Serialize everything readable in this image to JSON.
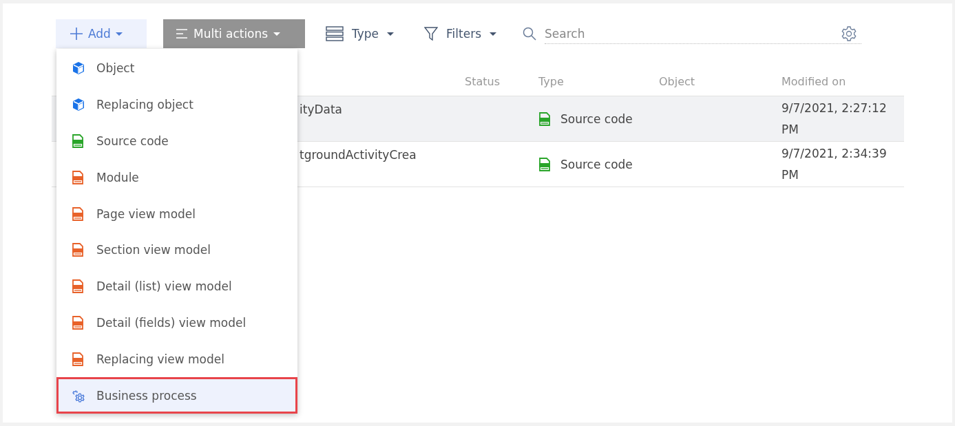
{
  "toolbar": {
    "add": {
      "label": "Add",
      "expanded": true
    },
    "multi_actions": {
      "label": "Multi actions"
    },
    "type_filter": {
      "label": "Type"
    },
    "filters": {
      "label": "Filters"
    },
    "search": {
      "placeholder": "Search"
    }
  },
  "table": {
    "columns": [
      "Status",
      "Type",
      "Object",
      "Modified on"
    ],
    "rows": [
      {
        "name": "ityData",
        "status": "",
        "type": "Source code",
        "object": "",
        "modified_on": "9/7/2021, 2:27:12 PM",
        "hovered": true
      },
      {
        "name": "tgroundActivityCrea",
        "status": "",
        "type": "Source code",
        "object": "",
        "modified_on": "9/7/2021, 2:34:39 PM",
        "hovered": false
      }
    ]
  },
  "add_menu": {
    "items": [
      {
        "label": "Object",
        "kind": "object",
        "selected": false
      },
      {
        "label": "Replacing object",
        "kind": "object",
        "selected": false
      },
      {
        "label": "Source code",
        "kind": "source",
        "selected": false
      },
      {
        "label": "Module",
        "kind": "js",
        "selected": false
      },
      {
        "label": "Page view model",
        "kind": "js",
        "selected": false
      },
      {
        "label": "Section view model",
        "kind": "js",
        "selected": false
      },
      {
        "label": "Detail (list) view model",
        "kind": "js",
        "selected": false
      },
      {
        "label": "Detail (fields) view model",
        "kind": "js",
        "selected": false
      },
      {
        "label": "Replacing view model",
        "kind": "js",
        "selected": false
      },
      {
        "label": "Business process",
        "kind": "process",
        "selected": true
      }
    ]
  }
}
